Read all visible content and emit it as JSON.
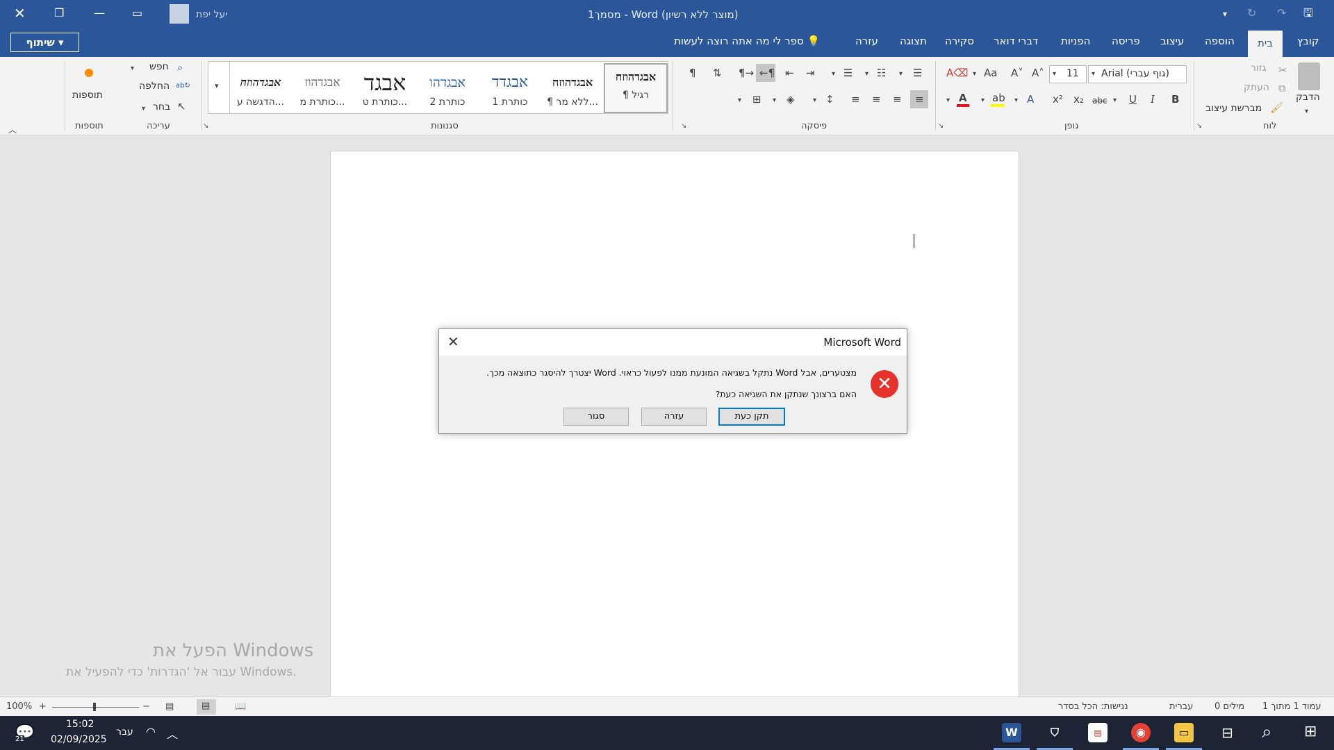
{
  "titlebar": {
    "title": "מסמך1  -  Word (מוצר ללא רשיון)",
    "user_name": "יעל יפת"
  },
  "tabs": {
    "share_label": "שיתוף",
    "tell_me": "ספר לי מה אתה רוצה לעשות",
    "items": [
      "קובץ",
      "בית",
      "הוספה",
      "עיצוב",
      "פריסה",
      "הפניות",
      "דברי דואר",
      "סקירה",
      "תצוגה",
      "עזרה"
    ]
  },
  "clipboard": {
    "paste": "הדבק",
    "cut": "גזור",
    "copy": "העתק",
    "format_painter": "מברשת עיצוב",
    "group": "לוח"
  },
  "font": {
    "name": "Arial (גוף עברי)",
    "size": "11",
    "group": "גופן",
    "bold": "B",
    "italic": "I",
    "underline": "U",
    "strike": "abc"
  },
  "paragraph": {
    "group": "פיסקה"
  },
  "styles": {
    "group": "סגנונות",
    "items": [
      {
        "sample": "אבגדהוזח",
        "name": "¶ רגיל"
      },
      {
        "sample": "אבגדהוזח",
        "name": "¶ ללא מר..."
      },
      {
        "sample": "אבגדד",
        "name": "כותרת 1"
      },
      {
        "sample": "אבגדהו",
        "name": "כותרת 2"
      },
      {
        "sample": "אבגד",
        "name": "כותרת ט..."
      },
      {
        "sample": "אבגדהוז",
        "name": "כותרת מ..."
      },
      {
        "sample": "אבגדהוזח",
        "name": "הדגשה ע..."
      }
    ]
  },
  "editing": {
    "find": "חפש",
    "replace": "החלפה",
    "select": "בחר",
    "group": "עריכה"
  },
  "addins": {
    "label": "תוספות",
    "group": "תוספות"
  },
  "dialog": {
    "title": "Microsoft Word",
    "line1": "מצטערים, אבל Word נתקל בשגיאה המונעת ממנו לפעול כראוי. Word יצטרך להיסגר כתוצאה מכך.",
    "line2": "האם ברצונך שנתקן את השגיאה כעת?",
    "btn_fix": "תקן כעת",
    "btn_help": "עזרה",
    "btn_close": "סגור"
  },
  "watermark": {
    "line1": "הפעל את Windows",
    "line2": "עבור אל 'הגדרות' כדי להפעיל את Windows."
  },
  "statusbar": {
    "page": "עמוד 1 מתוך 1",
    "words": "0 מילים",
    "language": "עברית",
    "accessibility": "נגישות: הכל בסדר",
    "zoom": "100%"
  },
  "taskbar": {
    "time": "15:02",
    "date": "02/09/2025",
    "lang": "עבר",
    "notif_count": "21"
  },
  "colors": {
    "accent": "#2b579a",
    "font_color": "#e81123",
    "highlight": "#ffff00",
    "error_icon": "#e5322b"
  }
}
